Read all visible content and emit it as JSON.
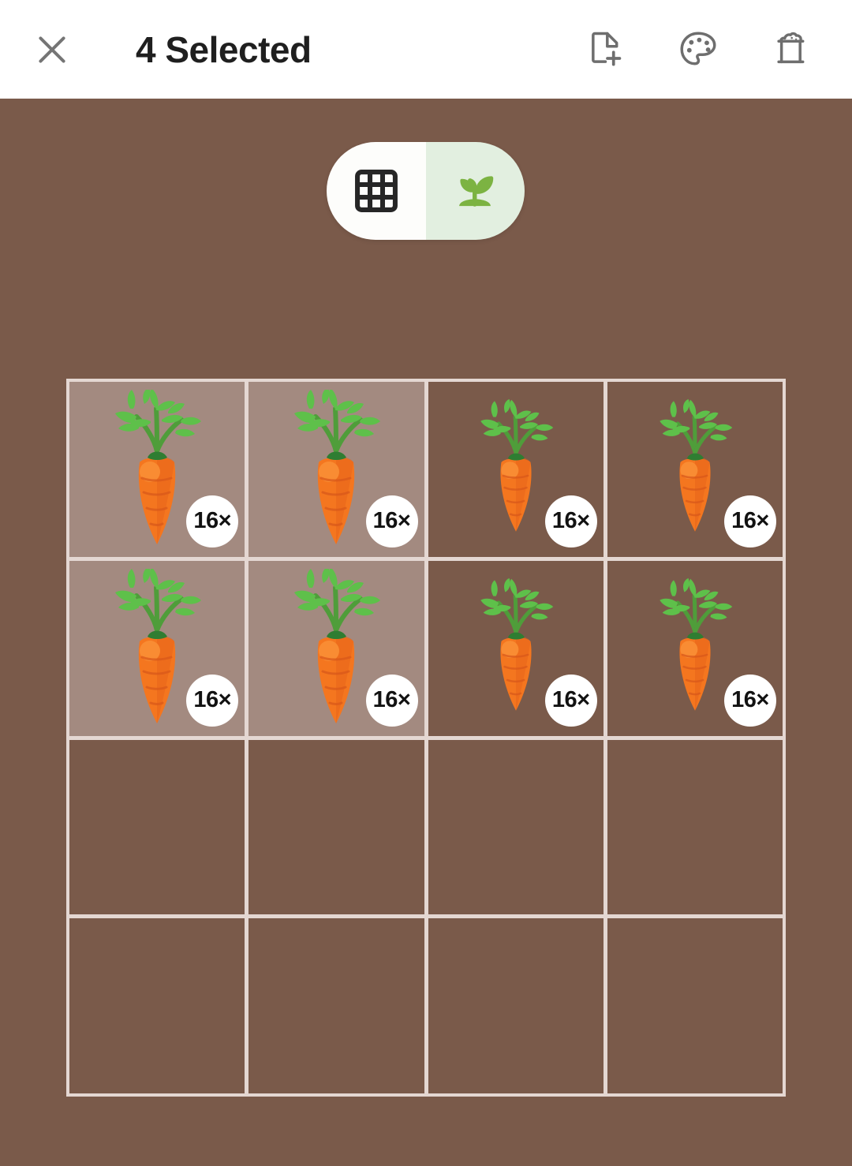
{
  "appbar": {
    "close_icon": "close-icon",
    "title": "4 Selected",
    "actions": [
      {
        "icon": "file-plus-icon",
        "label": "Add note"
      },
      {
        "icon": "palette-icon",
        "label": "Change color"
      },
      {
        "icon": "soil-bag-icon",
        "label": "Soil"
      }
    ]
  },
  "view_toggle": {
    "options": [
      {
        "icon": "grid-icon",
        "label": "Grid view",
        "selected": true
      },
      {
        "icon": "seedling-icon",
        "label": "Plant view",
        "selected": false
      }
    ],
    "grid_bg": "#fdfdfb",
    "plant_bg": "#e2efe0",
    "plant_color": "#7cb342"
  },
  "garden": {
    "columns": 4,
    "rows": 4,
    "soil_color": "#7a5a4a",
    "selected_color": "#a38a80",
    "gridline_color": "#e4d7d2",
    "selected_count": 4,
    "cells": [
      {
        "id": "r1c1",
        "plant": "carrot",
        "size": "big",
        "badge": "16×",
        "selected": true
      },
      {
        "id": "r1c2",
        "plant": "carrot",
        "size": "big",
        "badge": "16×",
        "selected": true
      },
      {
        "id": "r1c3",
        "plant": "carrot",
        "size": "small",
        "badge": "16×",
        "selected": false
      },
      {
        "id": "r1c4",
        "plant": "carrot",
        "size": "small",
        "badge": "16×",
        "selected": false
      },
      {
        "id": "r2c1",
        "plant": "carrot",
        "size": "big",
        "badge": "16×",
        "selected": true
      },
      {
        "id": "r2c2",
        "plant": "carrot",
        "size": "big",
        "badge": "16×",
        "selected": true
      },
      {
        "id": "r2c3",
        "plant": "carrot",
        "size": "small",
        "badge": "16×",
        "selected": false
      },
      {
        "id": "r2c4",
        "plant": "carrot",
        "size": "small",
        "badge": "16×",
        "selected": false
      },
      {
        "id": "r3c1",
        "plant": null,
        "size": null,
        "badge": null,
        "selected": false
      },
      {
        "id": "r3c2",
        "plant": null,
        "size": null,
        "badge": null,
        "selected": false
      },
      {
        "id": "r3c3",
        "plant": null,
        "size": null,
        "badge": null,
        "selected": false
      },
      {
        "id": "r3c4",
        "plant": null,
        "size": null,
        "badge": null,
        "selected": false
      },
      {
        "id": "r4c1",
        "plant": null,
        "size": null,
        "badge": null,
        "selected": false
      },
      {
        "id": "r4c2",
        "plant": null,
        "size": null,
        "badge": null,
        "selected": false
      },
      {
        "id": "r4c3",
        "plant": null,
        "size": null,
        "badge": null,
        "selected": false
      },
      {
        "id": "r4c4",
        "plant": null,
        "size": null,
        "badge": null,
        "selected": false
      }
    ]
  }
}
